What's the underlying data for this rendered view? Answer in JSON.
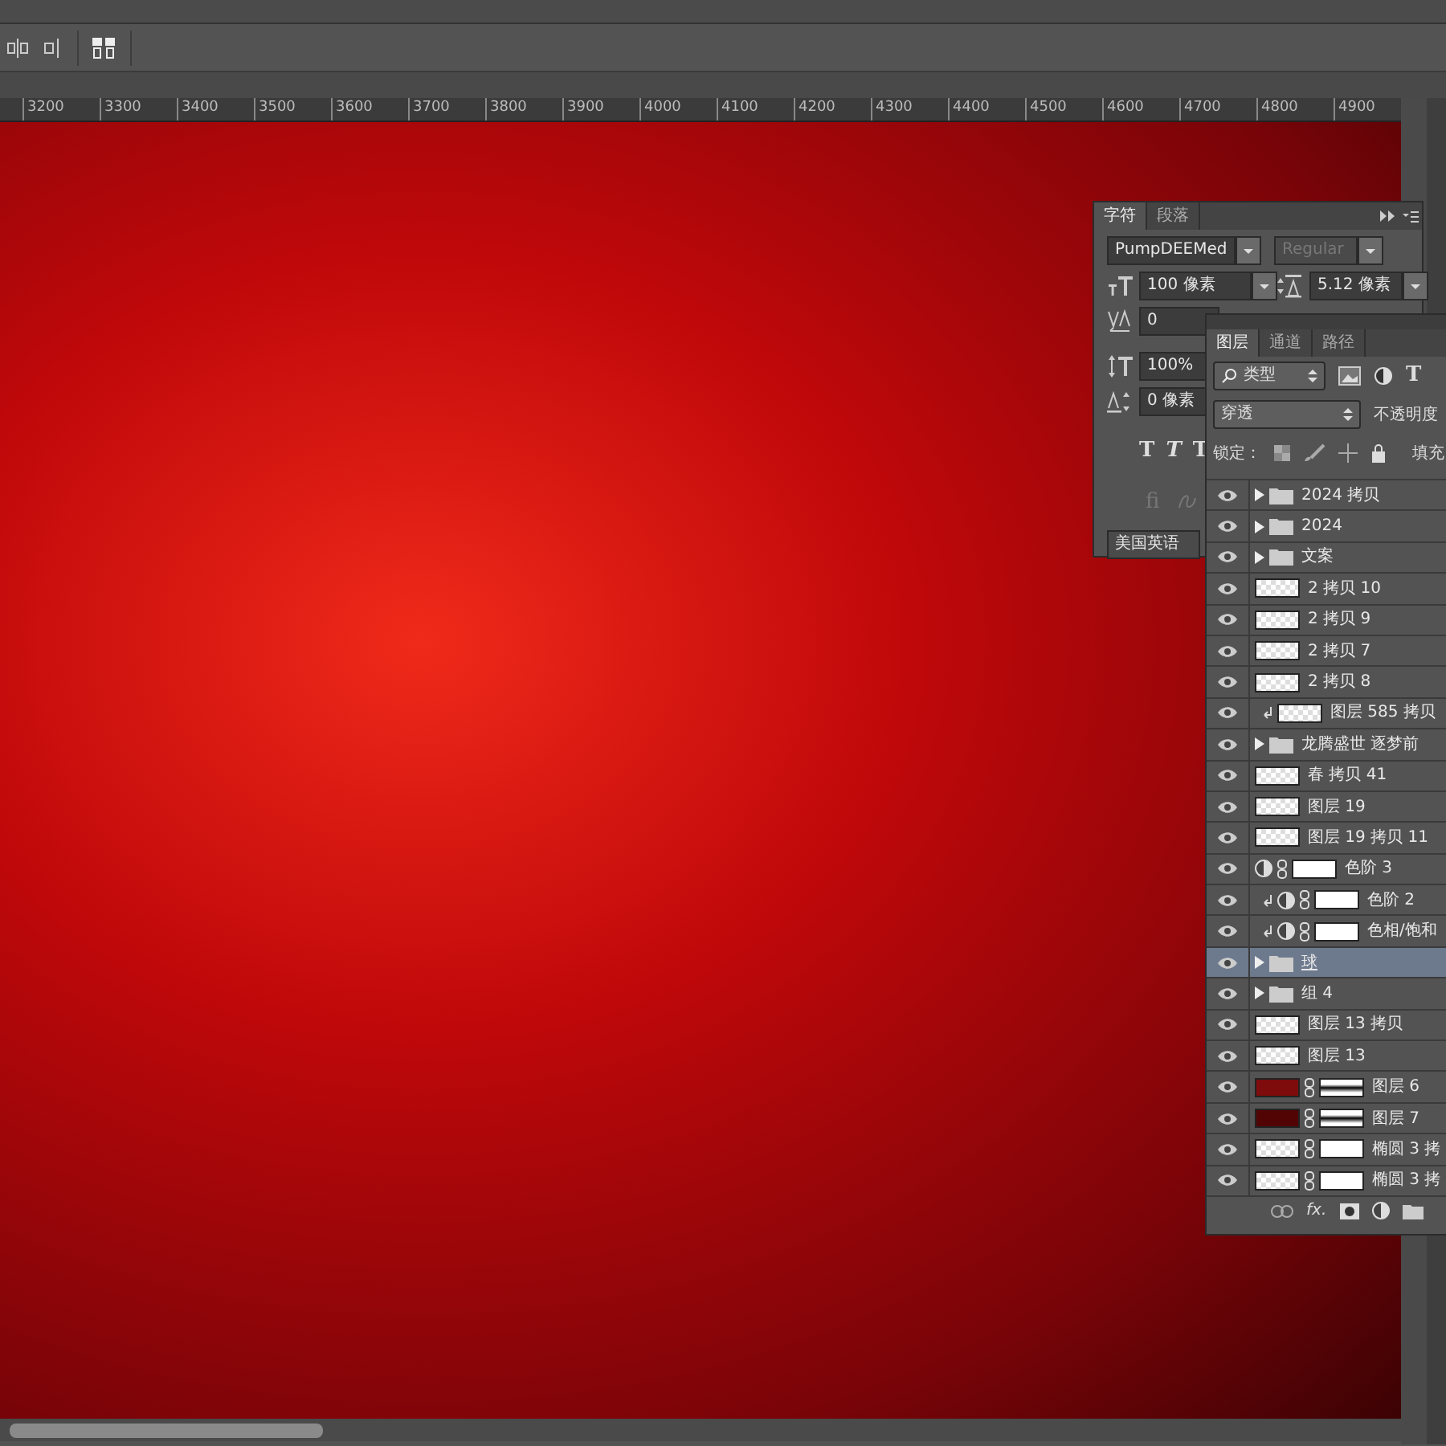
{
  "ruler": {
    "labels": [
      "3200",
      "3300",
      "3400",
      "3500",
      "3600",
      "3700",
      "3800",
      "3900",
      "4000",
      "4100",
      "4200",
      "4300",
      "4400",
      "4500",
      "4600",
      "4700",
      "4800",
      "4900"
    ]
  },
  "character_panel": {
    "tabs": [
      {
        "label": "字符",
        "selected": true
      },
      {
        "label": "段落",
        "selected": false
      }
    ],
    "font_family": "PumpDEEMed",
    "font_style": {
      "value": "Regular",
      "disabled": true
    },
    "font_size": "100 像素",
    "leading": "5.12 像素",
    "tracking": "0",
    "vertical_scale": "100%",
    "baseline_shift": "0 像素",
    "style_buttons": [
      "T",
      "T",
      "T"
    ],
    "ligature_button": "fi",
    "language": "美国英语"
  },
  "layers_panel": {
    "tabs": [
      {
        "label": "图层",
        "selected": true
      },
      {
        "label": "通道",
        "selected": false
      },
      {
        "label": "路径",
        "selected": false
      }
    ],
    "filter": "类型",
    "filter_text_button": "T",
    "blend_mode": "穿透",
    "opacity_label": "不透明度",
    "lock_label": "锁定：",
    "fill_label": "填充",
    "layers": [
      {
        "name": "2024 拷贝",
        "kind": "group",
        "mask": false,
        "clipped": false,
        "selected": false,
        "visible": true
      },
      {
        "name": "2024",
        "kind": "group",
        "mask": false,
        "clipped": false,
        "selected": false,
        "visible": true
      },
      {
        "name": "文案",
        "kind": "group",
        "mask": false,
        "clipped": false,
        "selected": false,
        "visible": true
      },
      {
        "name": "2 拷贝 10",
        "kind": "pixel",
        "mask": false,
        "clipped": false,
        "selected": false,
        "visible": true
      },
      {
        "name": "2 拷贝 9",
        "kind": "pixel",
        "mask": false,
        "clipped": false,
        "selected": false,
        "visible": true
      },
      {
        "name": "2 拷贝 7",
        "kind": "pixel",
        "mask": false,
        "clipped": false,
        "selected": false,
        "visible": true
      },
      {
        "name": "2 拷贝 8",
        "kind": "pixel",
        "mask": false,
        "clipped": false,
        "selected": false,
        "visible": true
      },
      {
        "name": "图层 585 拷贝",
        "kind": "pixel",
        "mask": false,
        "clipped": true,
        "selected": false,
        "visible": true
      },
      {
        "name": "龙腾盛世 逐梦前",
        "kind": "group",
        "mask": false,
        "clipped": false,
        "selected": false,
        "visible": true
      },
      {
        "name": "春 拷贝 41",
        "kind": "pixel",
        "mask": false,
        "clipped": false,
        "selected": false,
        "visible": true
      },
      {
        "name": "图层 19",
        "kind": "pixel",
        "mask": false,
        "clipped": false,
        "selected": false,
        "visible": true
      },
      {
        "name": "图层 19 拷贝 11",
        "kind": "pixel",
        "mask": false,
        "clipped": false,
        "selected": false,
        "visible": true
      },
      {
        "name": "色阶 3",
        "kind": "adjustment",
        "mask": true,
        "clipped": false,
        "selected": false,
        "visible": true
      },
      {
        "name": "色阶 2",
        "kind": "adjustment",
        "mask": true,
        "clipped": true,
        "selected": false,
        "visible": true
      },
      {
        "name": "色相/饱和",
        "kind": "adjustment",
        "mask": true,
        "clipped": true,
        "selected": false,
        "visible": true
      },
      {
        "name": "球",
        "kind": "group",
        "mask": false,
        "clipped": false,
        "selected": true,
        "visible": true
      },
      {
        "name": "组 4",
        "kind": "group",
        "mask": false,
        "clipped": false,
        "selected": false,
        "visible": true
      },
      {
        "name": "图层 13 拷贝",
        "kind": "pixel",
        "mask": false,
        "clipped": false,
        "selected": false,
        "visible": true
      },
      {
        "name": "图层 13",
        "kind": "pixel",
        "mask": false,
        "clipped": false,
        "selected": false,
        "visible": true
      },
      {
        "name": "图层 6",
        "kind": "solid",
        "color": "#7e0c0c",
        "mask": true,
        "clipped": false,
        "selected": false,
        "visible": true
      },
      {
        "name": "图层 7",
        "kind": "solid",
        "color": "#520404",
        "mask": true,
        "clipped": false,
        "selected": false,
        "visible": true
      },
      {
        "name": "椭圆 3 拷",
        "kind": "pixel",
        "mask": true,
        "clipped": false,
        "selected": false,
        "visible": true
      },
      {
        "name": "椭圆 3 拷",
        "kind": "pixel",
        "mask": true,
        "clipped": false,
        "selected": false,
        "visible": true
      }
    ],
    "footer_fx": "fx."
  }
}
